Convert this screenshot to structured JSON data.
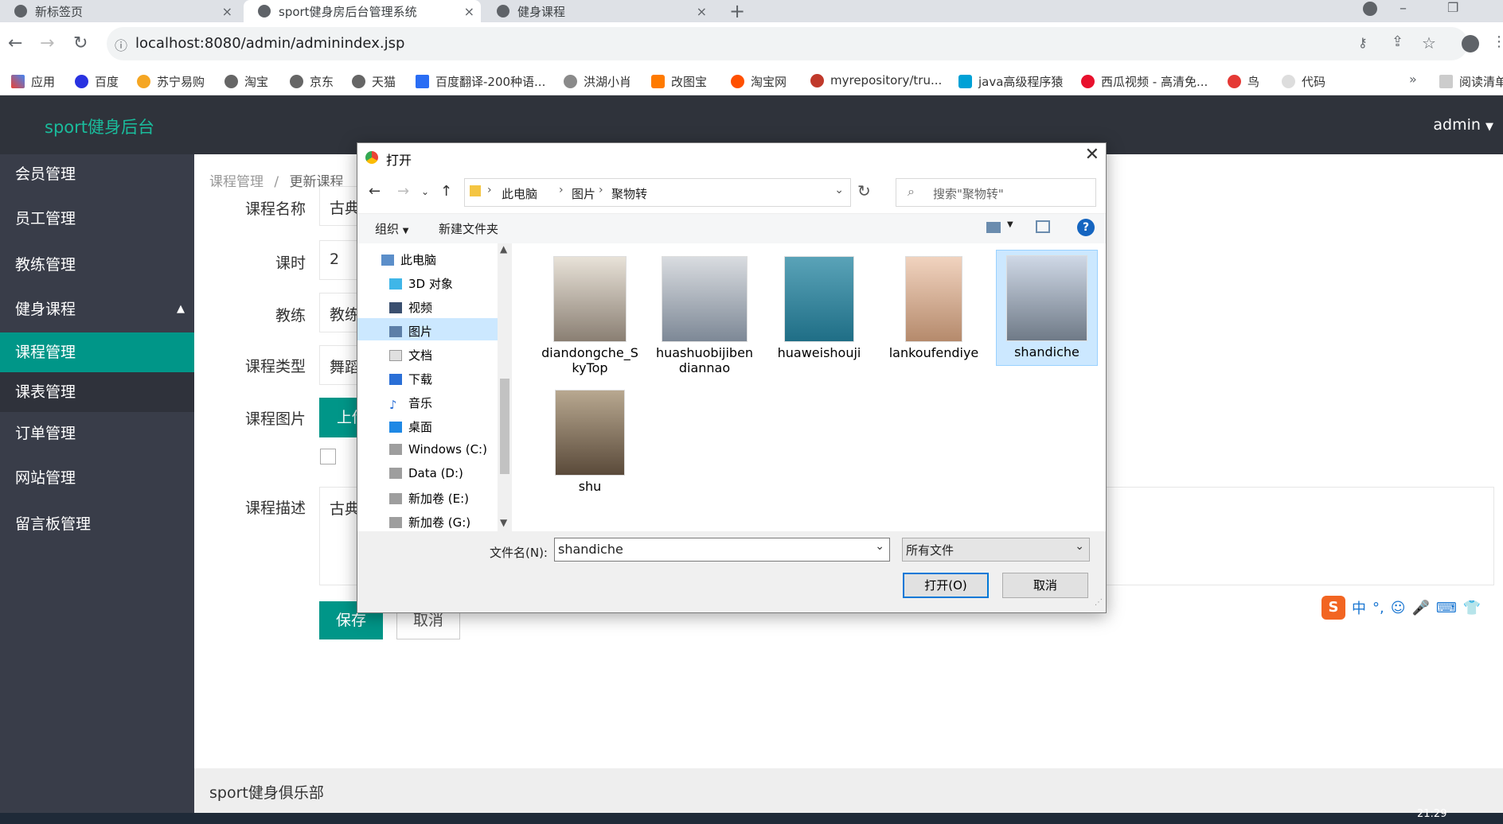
{
  "browser": {
    "tabs": [
      {
        "title": "新标签页"
      },
      {
        "title": "sport健身房后台管理系统"
      },
      {
        "title": "健身课程"
      }
    ],
    "url": "localhost:8080/admin/adminindex.jsp",
    "bookmarks": [
      "应用",
      "百度",
      "苏宁易购",
      "淘宝",
      "京东",
      "天猫",
      "百度翻译-200种语...",
      "洪湖小肖",
      "改图宝",
      "淘宝网",
      "myrepository/tru...",
      "java高级程序猿",
      "西瓜视频 - 高清免...",
      "鸟",
      "代码"
    ],
    "reading_list": "阅读清单"
  },
  "app": {
    "brand": "sport健身后台",
    "user": "admin",
    "sidebar": [
      {
        "label": "会员管理"
      },
      {
        "label": "员工管理"
      },
      {
        "label": "教练管理"
      },
      {
        "label": "健身课程"
      },
      {
        "label": "课程管理"
      },
      {
        "label": "课表管理"
      },
      {
        "label": "订单管理"
      },
      {
        "label": "网站管理"
      },
      {
        "label": "留言板管理"
      }
    ],
    "breadcrumb": {
      "parent": "课程管理",
      "sep": "/",
      "current": "更新课程"
    },
    "form": {
      "name_label": "课程名称",
      "name_value": "古典",
      "hours_label": "课时",
      "hours_value": "2",
      "coach_label": "教练",
      "coach_value": "教练",
      "type_label": "课程类型",
      "type_value": "舞蹈",
      "image_label": "课程图片",
      "upload_label": "上传",
      "desc_label": "课程描述",
      "desc_value": "古典",
      "save_label": "保存",
      "cancel_label": "取消"
    },
    "footer": "sport健身俱乐部"
  },
  "dialog": {
    "title": "打开",
    "path": [
      "此电脑",
      "图片",
      "聚物转"
    ],
    "search_placeholder": "搜索\"聚物转\"",
    "organize": "组织",
    "new_folder": "新建文件夹",
    "nav": [
      "此电脑",
      "3D 对象",
      "视频",
      "图片",
      "文档",
      "下载",
      "音乐",
      "桌面",
      "Windows (C:)",
      "Data (D:)",
      "新加卷 (E:)",
      "新加卷 (G:)"
    ],
    "files": [
      {
        "name": "diandongche_SkyTop",
        "line1": "diandongche_S",
        "line2": "kyTop"
      },
      {
        "name": "huashuobijibendiannao",
        "line1": "huashuobijiben",
        "line2": "diannao"
      },
      {
        "name": "huaweishouji",
        "line1": "huaweishouji",
        "line2": ""
      },
      {
        "name": "lankoufendiye",
        "line1": "lankoufendiye",
        "line2": ""
      },
      {
        "name": "shandiche",
        "line1": "shandiche",
        "line2": ""
      },
      {
        "name": "shu",
        "line1": "shu",
        "line2": ""
      }
    ],
    "filename_label": "文件名(N):",
    "filename_value": "shandiche",
    "filter_value": "所有文件",
    "open_label": "打开(O)",
    "cancel_label": "取消"
  },
  "clock": "21:29",
  "colors": {
    "accent": "#009688",
    "header": "#2f333b",
    "sidebar": "#393d49",
    "brand": "#1abc9c"
  }
}
